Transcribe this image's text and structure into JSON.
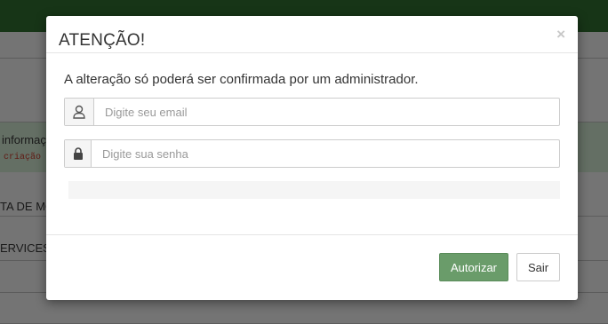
{
  "background": {
    "info_text": "informaç",
    "info_code": "criação",
    "row_texts": [
      "TA DE MO",
      "ERVICES"
    ]
  },
  "modal": {
    "title": "ATENÇÃO!",
    "close_symbol": "×",
    "message": "A alteração só poderá ser confirmada por um administrador.",
    "email_placeholder": "Digite seu email",
    "password_placeholder": "Digite sua senha",
    "authorize_label": "Autorizar",
    "exit_label": "Sair"
  },
  "icons": {
    "email_field": "user-icon",
    "password_field": "lock-icon"
  },
  "colors": {
    "header_bar": "#2f6b2f",
    "authorize_button": "#6a9c6a",
    "info_panel": "#c9dec9"
  }
}
